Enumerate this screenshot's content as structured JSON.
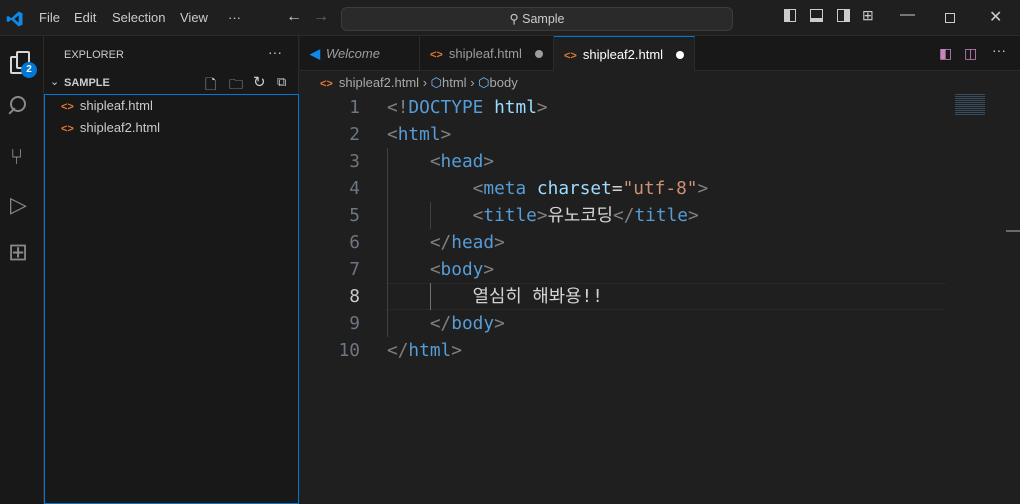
{
  "titlebar": {
    "menu": [
      "File",
      "Edit",
      "Selection",
      "View",
      "···"
    ],
    "search": "Sample"
  },
  "activity": {
    "explorer_badge": "2"
  },
  "sidebar": {
    "title": "EXPLORER",
    "more": "···",
    "folder": "SAMPLE",
    "files": [
      "shipleaf.html",
      "shipleaf2.html"
    ]
  },
  "tabs": [
    {
      "label": "Welcome"
    },
    {
      "label": "shipleaf.html"
    },
    {
      "label": "shipleaf2.html"
    }
  ],
  "breadcrumb": [
    "shipleaf2.html",
    "html",
    "body"
  ],
  "editor": {
    "current_line": 8,
    "lines": [
      {
        "n": "1",
        "tokens": [
          {
            "t": "<!",
            "c": "p"
          },
          {
            "t": "DOCTYPE",
            "c": "tag"
          },
          {
            "t": " ",
            "c": "txt"
          },
          {
            "t": "html",
            "c": "attr"
          },
          {
            "t": ">",
            "c": "p"
          }
        ]
      },
      {
        "n": "2",
        "tokens": [
          {
            "t": "<",
            "c": "p"
          },
          {
            "t": "html",
            "c": "tag"
          },
          {
            "t": ">",
            "c": "p"
          }
        ]
      },
      {
        "n": "3",
        "tokens": [
          {
            "t": "    <",
            "c": "p"
          },
          {
            "t": "head",
            "c": "tag"
          },
          {
            "t": ">",
            "c": "p"
          }
        ]
      },
      {
        "n": "4",
        "tokens": [
          {
            "t": "        <",
            "c": "p"
          },
          {
            "t": "meta",
            "c": "tag"
          },
          {
            "t": " ",
            "c": "txt"
          },
          {
            "t": "charset",
            "c": "attr"
          },
          {
            "t": "=",
            "c": "txt"
          },
          {
            "t": "\"utf-8\"",
            "c": "str"
          },
          {
            "t": ">",
            "c": "p"
          }
        ]
      },
      {
        "n": "5",
        "tokens": [
          {
            "t": "        <",
            "c": "p"
          },
          {
            "t": "title",
            "c": "tag"
          },
          {
            "t": ">",
            "c": "p"
          },
          {
            "t": "유노코딩",
            "c": "txt"
          },
          {
            "t": "</",
            "c": "p"
          },
          {
            "t": "title",
            "c": "tag"
          },
          {
            "t": ">",
            "c": "p"
          }
        ]
      },
      {
        "n": "6",
        "tokens": [
          {
            "t": "    </",
            "c": "p"
          },
          {
            "t": "head",
            "c": "tag"
          },
          {
            "t": ">",
            "c": "p"
          }
        ]
      },
      {
        "n": "7",
        "tokens": [
          {
            "t": "    <",
            "c": "p"
          },
          {
            "t": "body",
            "c": "tag"
          },
          {
            "t": ">",
            "c": "p"
          }
        ]
      },
      {
        "n": "8",
        "tokens": [
          {
            "t": "        열심히 해봐용!!",
            "c": "txt"
          }
        ]
      },
      {
        "n": "9",
        "tokens": [
          {
            "t": "    </",
            "c": "p"
          },
          {
            "t": "body",
            "c": "tag"
          },
          {
            "t": ">",
            "c": "p"
          }
        ]
      },
      {
        "n": "10",
        "tokens": [
          {
            "t": "</",
            "c": "p"
          },
          {
            "t": "html",
            "c": "tag"
          },
          {
            "t": ">",
            "c": "p"
          }
        ]
      }
    ]
  }
}
